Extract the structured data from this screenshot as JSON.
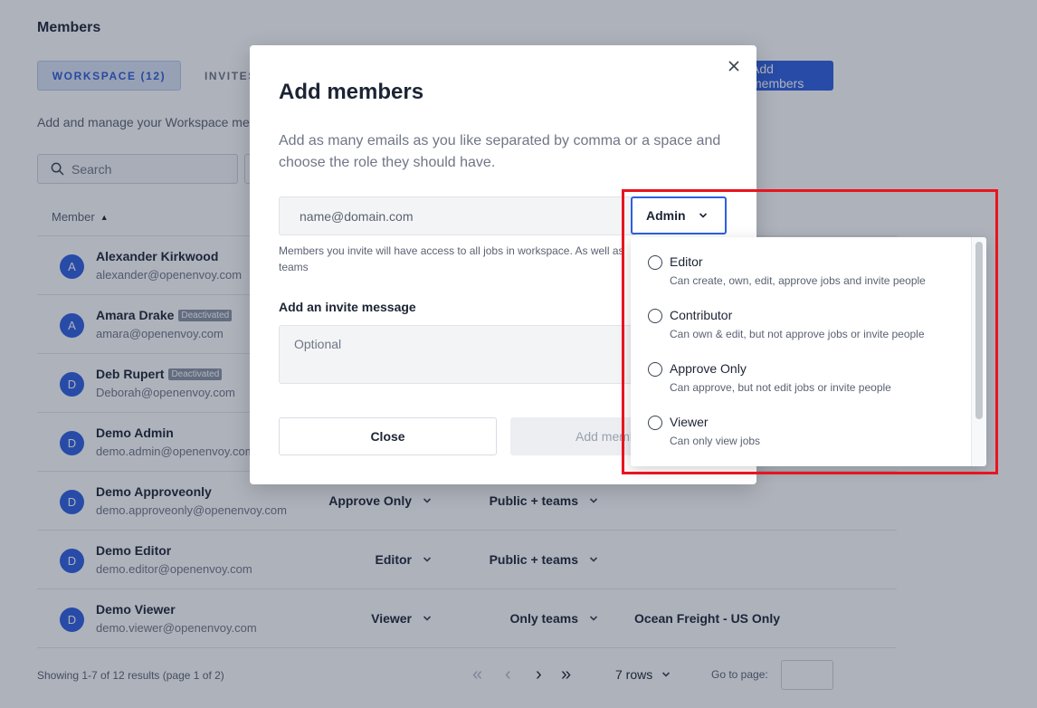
{
  "page": {
    "title": "Members",
    "tabs": [
      {
        "label": "WORKSPACE (12)",
        "active": true
      },
      {
        "label": "INVITES",
        "active": false
      }
    ],
    "add_button_label": "Add members",
    "subtitle": "Add and manage your Workspace members",
    "search_placeholder": "Search",
    "column_member": "Member",
    "members": [
      {
        "initial": "A",
        "name": "Alexander Kirkwood",
        "email": "alexander@openenvoy.com",
        "badge": "",
        "role": "",
        "access": "",
        "team": ""
      },
      {
        "initial": "A",
        "name": "Amara Drake",
        "email": "amara@openenvoy.com",
        "badge": "Deactivated",
        "role": "",
        "access": "",
        "team": ""
      },
      {
        "initial": "D",
        "name": "Deb Rupert",
        "email": "Deborah@openenvoy.com",
        "badge": "Deactivated",
        "role": "",
        "access": "",
        "team": ""
      },
      {
        "initial": "D",
        "name": "Demo Admin",
        "email": "demo.admin@openenvoy.com",
        "badge": "",
        "role": "",
        "access": "",
        "team": ""
      },
      {
        "initial": "D",
        "name": "Demo Approveonly",
        "email": "demo.approveonly@openenvoy.com",
        "badge": "",
        "role": "Approve Only",
        "access": "Public + teams",
        "team": ""
      },
      {
        "initial": "D",
        "name": "Demo Editor",
        "email": "demo.editor@openenvoy.com",
        "badge": "",
        "role": "Editor",
        "access": "Public + teams",
        "team": ""
      },
      {
        "initial": "D",
        "name": "Demo Viewer",
        "email": "demo.viewer@openenvoy.com",
        "badge": "",
        "role": "Viewer",
        "access": "Only teams",
        "team": "Ocean Freight - US Only"
      }
    ],
    "footer": {
      "showing": "Showing 1-7 of 12 results (page 1 of 2)",
      "rows_per_page": "7 rows",
      "go_to_page_label": "Go to page:"
    }
  },
  "modal": {
    "title": "Add members",
    "description": "Add as many emails as you like separated by comma or a space and choose the role they should have.",
    "email_placeholder": "name@domain.com",
    "invite_note": "Members you invite will have access to all jobs in workspace. As well as teams",
    "message_label": "Add an invite message",
    "message_placeholder": "Optional",
    "close_label": "Close",
    "add_label": "Add members"
  },
  "role_selector": {
    "selected": "Admin",
    "options": [
      {
        "label": "Editor",
        "description": "Can create, own, edit, approve jobs and invite people"
      },
      {
        "label": "Contributor",
        "description": "Can own & edit, but not approve jobs or invite people"
      },
      {
        "label": "Approve Only",
        "description": "Can approve, but not edit jobs or invite people"
      },
      {
        "label": "Viewer",
        "description": "Can only view jobs"
      }
    ]
  },
  "colors": {
    "accent": "#2d5fe0",
    "highlight": "#e8141f"
  }
}
